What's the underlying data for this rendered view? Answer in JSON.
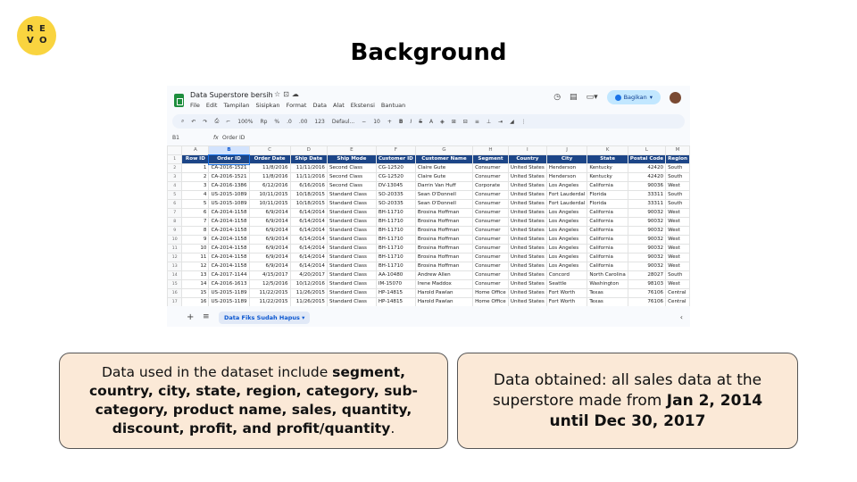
{
  "logo": {
    "letters": [
      "R",
      "E",
      "V",
      "O"
    ]
  },
  "slide": {
    "title": "Background"
  },
  "spreadsheet": {
    "doc_title": "Data Superstore bersih",
    "title_icons": [
      "star-icon",
      "move-to-folder-icon",
      "cloud-status-icon"
    ],
    "menu": [
      "File",
      "Edit",
      "Tampilan",
      "Sisipkan",
      "Format",
      "Data",
      "Alat",
      "Ekstensi",
      "Bantuan"
    ],
    "header_right": {
      "history_icon": "history-icon",
      "comment_icon": "comment-icon",
      "meet_icon": "video-icon",
      "share_label": "Bagikan"
    },
    "toolbar": {
      "zoom": "100%",
      "currency": "Rp",
      "percent": "%",
      "decimal_dec": ".0",
      "decimal_inc": ".00",
      "format_123": "123",
      "font": "Defaul...",
      "font_size": "10"
    },
    "formula_bar": {
      "cell_ref": "B1",
      "fx": "fx",
      "value": "Order ID"
    },
    "column_letters": [
      "A",
      "B",
      "C",
      "D",
      "E",
      "F",
      "G",
      "H",
      "I",
      "J",
      "K",
      "L",
      "M"
    ],
    "columns": [
      "Row ID",
      "Order ID",
      "Order Date",
      "Ship Date",
      "Ship Mode",
      "Customer ID",
      "Customer Name",
      "Segment",
      "Country",
      "City",
      "State",
      "Postal Code",
      "Region"
    ],
    "rows": [
      [
        "1",
        "CA-2016-1521",
        "11/8/2016",
        "11/11/2016",
        "Second Class",
        "CG-12520",
        "Claire Gute",
        "Consumer",
        "United States",
        "Henderson",
        "Kentucky",
        "42420",
        "South"
      ],
      [
        "2",
        "CA-2016-1521",
        "11/8/2016",
        "11/11/2016",
        "Second Class",
        "CG-12520",
        "Claire Gute",
        "Consumer",
        "United States",
        "Henderson",
        "Kentucky",
        "42420",
        "South"
      ],
      [
        "3",
        "CA-2016-1386",
        "6/12/2016",
        "6/16/2016",
        "Second Class",
        "DV-13045",
        "Darrin Van Huff",
        "Corporate",
        "United States",
        "Los Angeles",
        "California",
        "90036",
        "West"
      ],
      [
        "4",
        "US-2015-1089",
        "10/11/2015",
        "10/18/2015",
        "Standard Class",
        "SO-20335",
        "Sean O'Donnell",
        "Consumer",
        "United States",
        "Fort Lauderdal",
        "Florida",
        "33311",
        "South"
      ],
      [
        "5",
        "US-2015-1089",
        "10/11/2015",
        "10/18/2015",
        "Standard Class",
        "SO-20335",
        "Sean O'Donnell",
        "Consumer",
        "United States",
        "Fort Lauderdal",
        "Florida",
        "33311",
        "South"
      ],
      [
        "6",
        "CA-2014-1158",
        "6/9/2014",
        "6/14/2014",
        "Standard Class",
        "BH-11710",
        "Brosina Hoffman",
        "Consumer",
        "United States",
        "Los Angeles",
        "California",
        "90032",
        "West"
      ],
      [
        "7",
        "CA-2014-1158",
        "6/9/2014",
        "6/14/2014",
        "Standard Class",
        "BH-11710",
        "Brosina Hoffman",
        "Consumer",
        "United States",
        "Los Angeles",
        "California",
        "90032",
        "West"
      ],
      [
        "8",
        "CA-2014-1158",
        "6/9/2014",
        "6/14/2014",
        "Standard Class",
        "BH-11710",
        "Brosina Hoffman",
        "Consumer",
        "United States",
        "Los Angeles",
        "California",
        "90032",
        "West"
      ],
      [
        "9",
        "CA-2014-1158",
        "6/9/2014",
        "6/14/2014",
        "Standard Class",
        "BH-11710",
        "Brosina Hoffman",
        "Consumer",
        "United States",
        "Los Angeles",
        "California",
        "90032",
        "West"
      ],
      [
        "10",
        "CA-2014-1158",
        "6/9/2014",
        "6/14/2014",
        "Standard Class",
        "BH-11710",
        "Brosina Hoffman",
        "Consumer",
        "United States",
        "Los Angeles",
        "California",
        "90032",
        "West"
      ],
      [
        "11",
        "CA-2014-1158",
        "6/9/2014",
        "6/14/2014",
        "Standard Class",
        "BH-11710",
        "Brosina Hoffman",
        "Consumer",
        "United States",
        "Los Angeles",
        "California",
        "90032",
        "West"
      ],
      [
        "12",
        "CA-2014-1158",
        "6/9/2014",
        "6/14/2014",
        "Standard Class",
        "BH-11710",
        "Brosina Hoffman",
        "Consumer",
        "United States",
        "Los Angeles",
        "California",
        "90032",
        "West"
      ],
      [
        "13",
        "CA-2017-1144",
        "4/15/2017",
        "4/20/2017",
        "Standard Class",
        "AA-10480",
        "Andrew Allen",
        "Consumer",
        "United States",
        "Concord",
        "North Carolina",
        "28027",
        "South"
      ],
      [
        "14",
        "CA-2016-1613",
        "12/5/2016",
        "10/12/2016",
        "Standard Class",
        "IM-15070",
        "Irene Maddox",
        "Consumer",
        "United States",
        "Seattle",
        "Washington",
        "98103",
        "West"
      ],
      [
        "15",
        "US-2015-1189",
        "11/22/2015",
        "11/26/2015",
        "Standard Class",
        "HP-14815",
        "Harold Pawlan",
        "Home Office",
        "United States",
        "Fort Worth",
        "Texas",
        "76106",
        "Central"
      ],
      [
        "16",
        "US-2015-1189",
        "11/22/2015",
        "11/26/2015",
        "Standard Class",
        "HP-14815",
        "Harold Pawlan",
        "Home Office",
        "United States",
        "Fort Worth",
        "Texas",
        "76106",
        "Central"
      ]
    ],
    "sheet_tab": "Data Fiks Sudah Hapus"
  },
  "box_left": {
    "prefix": "Data used in the dataset include ",
    "bold": "segment, country, city, state, region, category, sub-category, product name, sales, quantity, discount, profit, and profit/quantity",
    "suffix": "."
  },
  "box_right": {
    "prefix": "Data obtained: all sales data at the superstore made from ",
    "bold": "Jan 2, 2014 until Dec 30, 2017"
  },
  "colors": {
    "logo_yellow": "#f9d43f",
    "header_blue": "#1c4587",
    "box_fill": "#fbe9d7"
  }
}
